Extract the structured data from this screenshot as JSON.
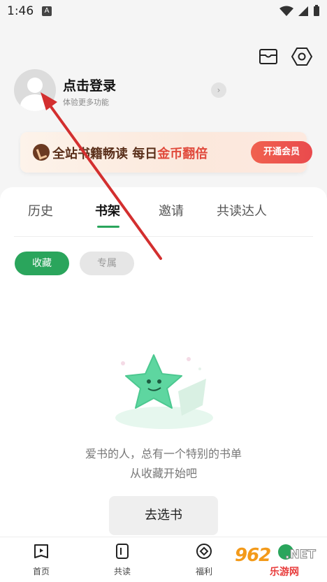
{
  "status_bar": {
    "time": "1:46",
    "indicator": "A"
  },
  "header": {
    "login_title": "点击登录",
    "login_subtitle": "体验更多功能",
    "arrow": "›"
  },
  "vip_banner": {
    "text_part1": "全站书籍畅读 每日",
    "text_highlight": "金币翻倍",
    "button_label": "开通会员"
  },
  "tabs": [
    {
      "label": "历史",
      "active": false
    },
    {
      "label": "书架",
      "active": true
    },
    {
      "label": "邀请",
      "active": false
    },
    {
      "label": "共读达人",
      "active": false
    }
  ],
  "chips": [
    {
      "label": "收藏",
      "active": true
    },
    {
      "label": "专属",
      "active": false
    }
  ],
  "empty_state": {
    "line1": "爱书的人，总有一个特别的书单",
    "line2": "从收藏开始吧",
    "button_label": "去选书"
  },
  "bottom_nav": [
    {
      "label": "首页",
      "icon": "home-book-icon"
    },
    {
      "label": "共读",
      "icon": "read-together-icon"
    },
    {
      "label": "福利",
      "icon": "welfare-icon"
    }
  ],
  "watermark": {
    "number": "962",
    "suffix": ".NET",
    "caption": "乐游网"
  },
  "colors": {
    "accent": "#2aa55c",
    "vip_red": "#e94a4d",
    "arrow_red": "#d32f2f"
  }
}
